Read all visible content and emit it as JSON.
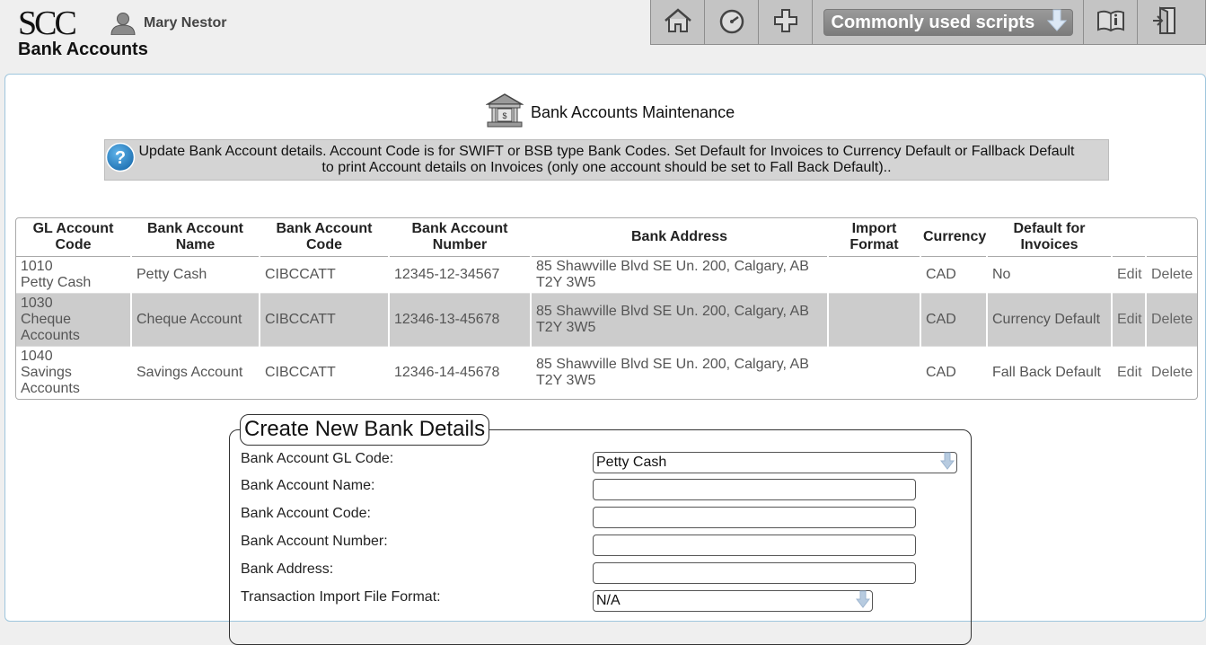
{
  "header": {
    "logo": "SCC",
    "user_name": "Mary Nestor",
    "page_title": "Bank Accounts",
    "scripts_label": "Commonly used scripts",
    "icons": [
      "home-icon",
      "dashboard-icon",
      "plus-icon",
      "chevron-down-icon",
      "book-info-icon",
      "exit-door-icon"
    ],
    "toolbar_color": "#c4c4c4"
  },
  "main": {
    "title": "Bank Accounts Maintenance",
    "info_line1": "Update Bank Account details. Account Code is for SWIFT or BSB type Bank Codes. Set Default for Invoices to Currency Default or Fallback Default",
    "info_line2": "to print Account details on Invoices (only one account should be set to Fall Back Default).."
  },
  "table": {
    "headers": [
      "GL Account Code",
      "Bank Account Name",
      "Bank Account Code",
      "Bank Account Number",
      "Bank Address",
      "Import Format",
      "Currency",
      "Default for Invoices",
      "",
      ""
    ],
    "rows": [
      {
        "gl": "1010\nPetty Cash",
        "name": "Petty Cash",
        "code": "CIBCCATT",
        "number": "12345-12-34567",
        "address": "85 Shawville Blvd SE Un. 200, Calgary, AB T2Y 3W5",
        "import_format": "",
        "currency": "CAD",
        "default": "No",
        "edit": "Edit",
        "delete": "Delete"
      },
      {
        "gl": "1030\nCheque Accounts",
        "name": "Cheque Account",
        "code": "CIBCCATT",
        "number": "12346-13-45678",
        "address": "85 Shawville Blvd SE Un. 200, Calgary, AB T2Y 3W5",
        "import_format": "",
        "currency": "CAD",
        "default": "Currency Default",
        "edit": "Edit",
        "delete": "Delete"
      },
      {
        "gl": "1040\nSavings Accounts",
        "name": "Savings Account",
        "code": "CIBCCATT",
        "number": "12346-14-45678",
        "address": "85 Shawville Blvd SE Un. 200, Calgary, AB T2Y 3W5",
        "import_format": "",
        "currency": "CAD",
        "default": "Fall Back Default",
        "edit": "Edit",
        "delete": "Delete"
      }
    ]
  },
  "create": {
    "legend": "Create New Bank Details",
    "gl_code_label": "Bank Account GL Code:",
    "gl_code_value": "Petty Cash",
    "name_label": "Bank Account Name:",
    "name_value": "",
    "code_label": "Bank Account Code:",
    "code_value": "",
    "number_label": "Bank Account Number:",
    "number_value": "",
    "address_label": "Bank Address:",
    "address_value": "",
    "import_label": "Transaction Import File Format:",
    "import_value": "N/A"
  }
}
